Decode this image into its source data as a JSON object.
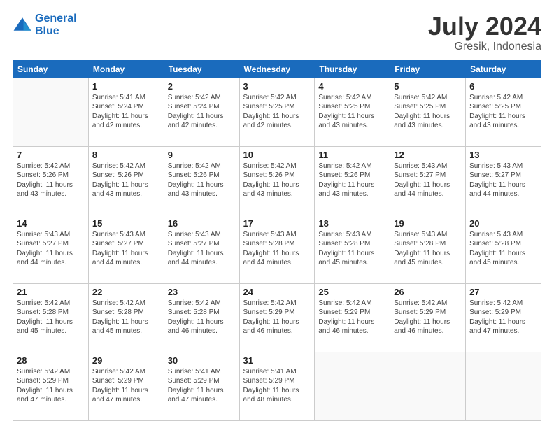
{
  "logo": {
    "line1": "General",
    "line2": "Blue"
  },
  "title": {
    "month_year": "July 2024",
    "location": "Gresik, Indonesia"
  },
  "weekdays": [
    "Sunday",
    "Monday",
    "Tuesday",
    "Wednesday",
    "Thursday",
    "Friday",
    "Saturday"
  ],
  "weeks": [
    [
      {
        "day": "",
        "detail": ""
      },
      {
        "day": "1",
        "detail": "Sunrise: 5:41 AM\nSunset: 5:24 PM\nDaylight: 11 hours\nand 42 minutes."
      },
      {
        "day": "2",
        "detail": "Sunrise: 5:42 AM\nSunset: 5:24 PM\nDaylight: 11 hours\nand 42 minutes."
      },
      {
        "day": "3",
        "detail": "Sunrise: 5:42 AM\nSunset: 5:25 PM\nDaylight: 11 hours\nand 42 minutes."
      },
      {
        "day": "4",
        "detail": "Sunrise: 5:42 AM\nSunset: 5:25 PM\nDaylight: 11 hours\nand 43 minutes."
      },
      {
        "day": "5",
        "detail": "Sunrise: 5:42 AM\nSunset: 5:25 PM\nDaylight: 11 hours\nand 43 minutes."
      },
      {
        "day": "6",
        "detail": "Sunrise: 5:42 AM\nSunset: 5:25 PM\nDaylight: 11 hours\nand 43 minutes."
      }
    ],
    [
      {
        "day": "7",
        "detail": "Sunrise: 5:42 AM\nSunset: 5:26 PM\nDaylight: 11 hours\nand 43 minutes."
      },
      {
        "day": "8",
        "detail": "Sunrise: 5:42 AM\nSunset: 5:26 PM\nDaylight: 11 hours\nand 43 minutes."
      },
      {
        "day": "9",
        "detail": "Sunrise: 5:42 AM\nSunset: 5:26 PM\nDaylight: 11 hours\nand 43 minutes."
      },
      {
        "day": "10",
        "detail": "Sunrise: 5:42 AM\nSunset: 5:26 PM\nDaylight: 11 hours\nand 43 minutes."
      },
      {
        "day": "11",
        "detail": "Sunrise: 5:42 AM\nSunset: 5:26 PM\nDaylight: 11 hours\nand 43 minutes."
      },
      {
        "day": "12",
        "detail": "Sunrise: 5:43 AM\nSunset: 5:27 PM\nDaylight: 11 hours\nand 44 minutes."
      },
      {
        "day": "13",
        "detail": "Sunrise: 5:43 AM\nSunset: 5:27 PM\nDaylight: 11 hours\nand 44 minutes."
      }
    ],
    [
      {
        "day": "14",
        "detail": "Sunrise: 5:43 AM\nSunset: 5:27 PM\nDaylight: 11 hours\nand 44 minutes."
      },
      {
        "day": "15",
        "detail": "Sunrise: 5:43 AM\nSunset: 5:27 PM\nDaylight: 11 hours\nand 44 minutes."
      },
      {
        "day": "16",
        "detail": "Sunrise: 5:43 AM\nSunset: 5:27 PM\nDaylight: 11 hours\nand 44 minutes."
      },
      {
        "day": "17",
        "detail": "Sunrise: 5:43 AM\nSunset: 5:28 PM\nDaylight: 11 hours\nand 44 minutes."
      },
      {
        "day": "18",
        "detail": "Sunrise: 5:43 AM\nSunset: 5:28 PM\nDaylight: 11 hours\nand 45 minutes."
      },
      {
        "day": "19",
        "detail": "Sunrise: 5:43 AM\nSunset: 5:28 PM\nDaylight: 11 hours\nand 45 minutes."
      },
      {
        "day": "20",
        "detail": "Sunrise: 5:43 AM\nSunset: 5:28 PM\nDaylight: 11 hours\nand 45 minutes."
      }
    ],
    [
      {
        "day": "21",
        "detail": "Sunrise: 5:42 AM\nSunset: 5:28 PM\nDaylight: 11 hours\nand 45 minutes."
      },
      {
        "day": "22",
        "detail": "Sunrise: 5:42 AM\nSunset: 5:28 PM\nDaylight: 11 hours\nand 45 minutes."
      },
      {
        "day": "23",
        "detail": "Sunrise: 5:42 AM\nSunset: 5:28 PM\nDaylight: 11 hours\nand 46 minutes."
      },
      {
        "day": "24",
        "detail": "Sunrise: 5:42 AM\nSunset: 5:29 PM\nDaylight: 11 hours\nand 46 minutes."
      },
      {
        "day": "25",
        "detail": "Sunrise: 5:42 AM\nSunset: 5:29 PM\nDaylight: 11 hours\nand 46 minutes."
      },
      {
        "day": "26",
        "detail": "Sunrise: 5:42 AM\nSunset: 5:29 PM\nDaylight: 11 hours\nand 46 minutes."
      },
      {
        "day": "27",
        "detail": "Sunrise: 5:42 AM\nSunset: 5:29 PM\nDaylight: 11 hours\nand 47 minutes."
      }
    ],
    [
      {
        "day": "28",
        "detail": "Sunrise: 5:42 AM\nSunset: 5:29 PM\nDaylight: 11 hours\nand 47 minutes."
      },
      {
        "day": "29",
        "detail": "Sunrise: 5:42 AM\nSunset: 5:29 PM\nDaylight: 11 hours\nand 47 minutes."
      },
      {
        "day": "30",
        "detail": "Sunrise: 5:41 AM\nSunset: 5:29 PM\nDaylight: 11 hours\nand 47 minutes."
      },
      {
        "day": "31",
        "detail": "Sunrise: 5:41 AM\nSunset: 5:29 PM\nDaylight: 11 hours\nand 48 minutes."
      },
      {
        "day": "",
        "detail": ""
      },
      {
        "day": "",
        "detail": ""
      },
      {
        "day": "",
        "detail": ""
      }
    ]
  ]
}
